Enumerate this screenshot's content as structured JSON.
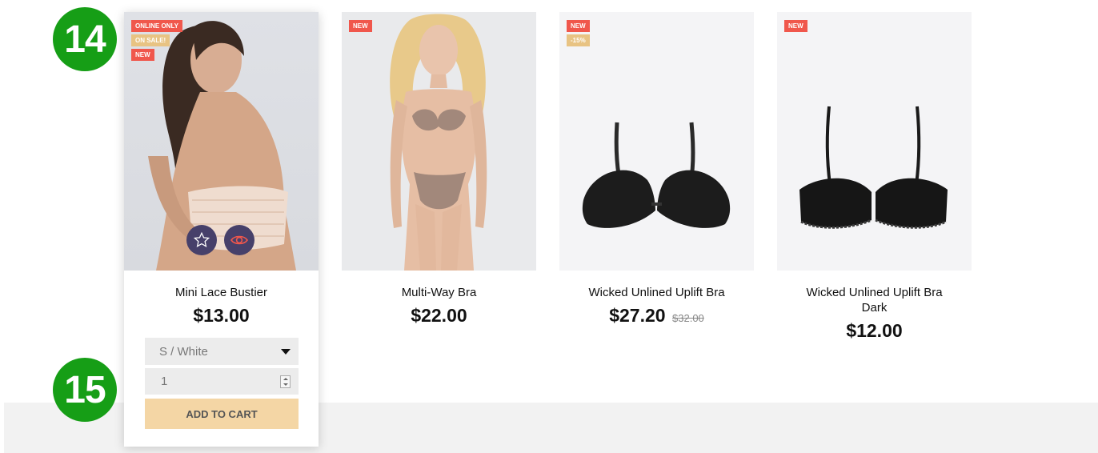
{
  "callouts": {
    "first": "14",
    "second": "15"
  },
  "products": [
    {
      "title": "Mini Lace Bustier",
      "price": "$13.00",
      "badges": [
        "ONLINE ONLY",
        "ON SALE!",
        "NEW"
      ]
    },
    {
      "title": "Multi-Way Bra",
      "price": "$22.00",
      "badges": [
        "NEW"
      ]
    },
    {
      "title": "Wicked Unlined Uplift Bra",
      "price": "$27.20",
      "old_price": "$32.00",
      "badges": [
        "NEW",
        "-15%"
      ]
    },
    {
      "title": "Wicked Unlined Uplift Bra Dark",
      "price": "$12.00",
      "badges": [
        "NEW"
      ]
    }
  ],
  "quick_icons": {
    "wishlist": "star-icon",
    "quick_view": "eye-icon"
  },
  "add_form": {
    "variant_selected": "S / White",
    "quantity": "1",
    "add_to_cart_label": "ADD TO CART"
  },
  "colors": {
    "badge_red": "#f0574c",
    "badge_gold": "#e8c383",
    "callout_green": "#169e16",
    "button_bg": "#f4d6a5",
    "icon_bg": "#46406a"
  }
}
